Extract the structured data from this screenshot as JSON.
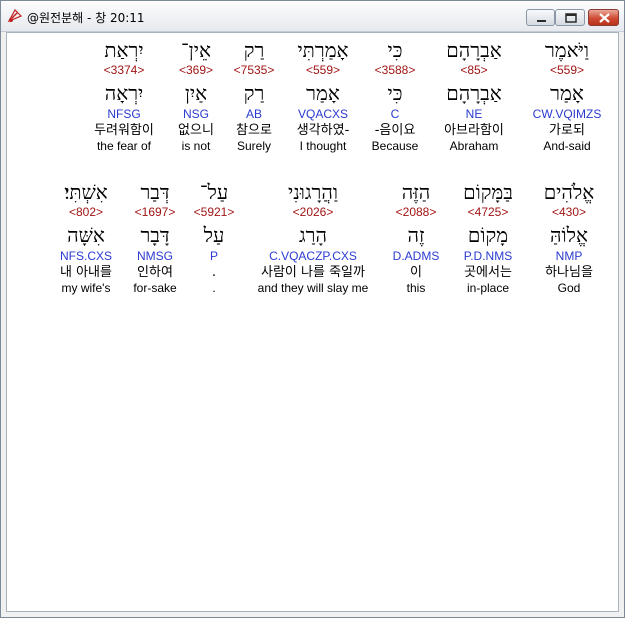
{
  "window": {
    "title": "@원전분해 - 창 20:11",
    "controls": [
      "minimize-icon",
      "maximize-icon",
      "close-icon"
    ]
  },
  "colors": {
    "strong_number": "#a11515",
    "parsing": "#2a3ad0",
    "text": "#000000"
  },
  "rows": [
    [
      {
        "heb": "וַיֹּאמֶר",
        "num": "<559>",
        "lemma": "אָמַר",
        "parse": "CW.VQIMZS",
        "kor": "가로되",
        "eng": "And-said"
      },
      {
        "heb": "אַבְרָהָם",
        "num": "<85>",
        "lemma": "אַבְרָהָם",
        "parse": "NE",
        "kor": "아브라함이",
        "eng": "Abraham"
      },
      {
        "heb": "כִּי",
        "num": "<3588>",
        "lemma": "כִּי",
        "parse": "C",
        "kor": "-음이요",
        "eng": "Because"
      },
      {
        "heb": "אָמַרְתִּי",
        "num": "<559>",
        "lemma": "אָמַר",
        "parse": "VQACXS",
        "kor": "생각하였-",
        "eng": "I thought"
      },
      {
        "heb": "רַק",
        "num": "<7535>",
        "lemma": "רַק",
        "parse": "AB",
        "kor": "참으로",
        "eng": "Surely"
      },
      {
        "heb": "אֵין־",
        "num": "<369>",
        "lemma": "אַיִן",
        "parse": "NSG",
        "kor": "없으니",
        "eng": "is not"
      },
      {
        "heb": "יִרְאַת",
        "num": "<3374>",
        "lemma": "יִרְאָה",
        "parse": "NFSG",
        "kor": "두려워함이",
        "eng": "the fear of"
      }
    ],
    [
      {
        "heb": "אֱלֹהִים",
        "num": "<430>",
        "lemma": "אֱלוֹהַּ",
        "parse": "NMP",
        "kor": "하나님을",
        "eng": "God"
      },
      {
        "heb": "בַּמָּקוֹם",
        "num": "<4725>",
        "lemma": "מָקוֹם",
        "parse": "P.D.NMS",
        "kor": "곳에서는",
        "eng": "in-place"
      },
      {
        "heb": "הַזֶּה",
        "num": "<2088>",
        "lemma": "זֶה",
        "parse": "D.ADMS",
        "kor": "이",
        "eng": "this"
      },
      {
        "heb": "וַהֲרָגוּנִי",
        "num": "<2026>",
        "lemma": "הָרַג",
        "parse": "C.VQACZP.CXS",
        "kor": "사람이 나를 죽일까",
        "eng": "and they will slay me"
      },
      {
        "heb": "עַל־",
        "num": "<5921>",
        "lemma": "עַל",
        "parse": "P",
        "kor": ".",
        "eng": "."
      },
      {
        "heb": "דְּבַר",
        "num": "<1697>",
        "lemma": "דָּבָר",
        "parse": "NMSG",
        "kor": "인하여",
        "eng": "for-sake"
      },
      {
        "heb": "אִשְׁתִּי׃",
        "num": "<802>",
        "lemma": "אִשָּׁה",
        "parse": "NFS.CXS",
        "kor": "내 아내를",
        "eng": "my wife's"
      }
    ]
  ]
}
